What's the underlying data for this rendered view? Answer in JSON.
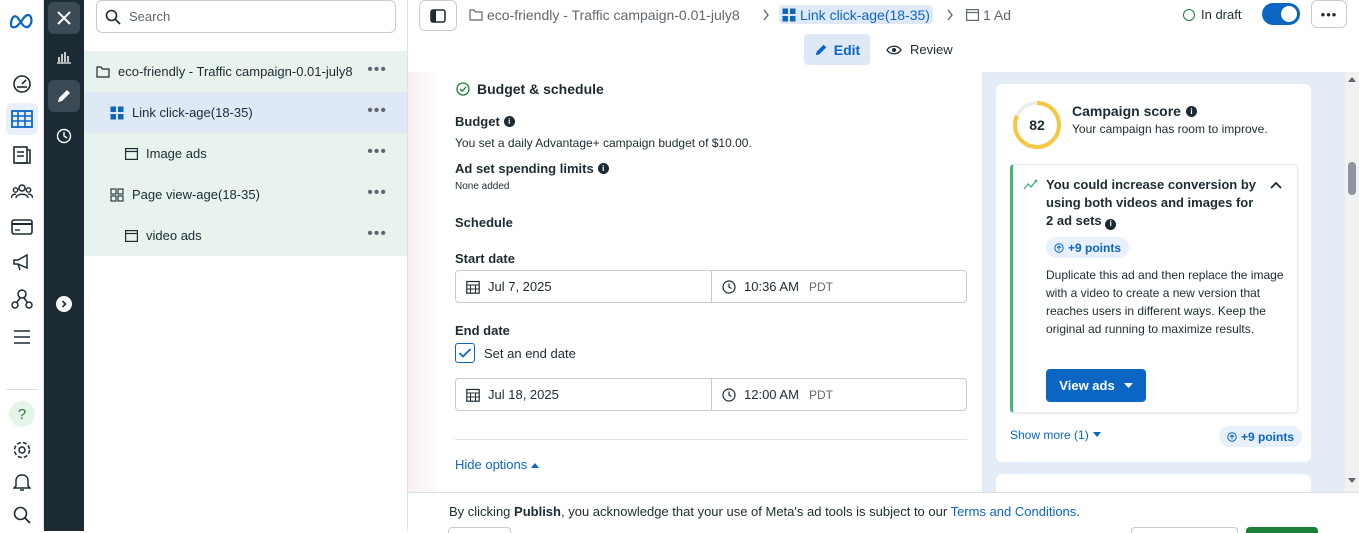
{
  "rail": {
    "items": [
      "meta-logo",
      "dashboard-icon",
      "campaigns-table-icon",
      "catalog-icon",
      "audiences-icon",
      "billing-icon",
      "ads-megaphone-icon",
      "connections-icon",
      "menu-icon",
      "help-icon",
      "settings-icon",
      "notifications-icon",
      "search-icon"
    ]
  },
  "tree": {
    "search_placeholder": "Search",
    "items": [
      {
        "label": "eco-friendly - Traffic campaign-0.01-july8",
        "type": "campaign"
      },
      {
        "label": "Link click-age(18-35)",
        "type": "adset"
      },
      {
        "label": "Image ads",
        "type": "ad"
      },
      {
        "label": "Page view-age(18-35)",
        "type": "adset"
      },
      {
        "label": "video ads",
        "type": "ad"
      }
    ],
    "more_label": "•••"
  },
  "topbar": {
    "breadcrumb": {
      "campaign": "eco-friendly - Traffic campaign-0.01-july8",
      "adset": "Link click-age(18-35)",
      "ad": "1 Ad"
    },
    "status": "In draft",
    "edit_label": "Edit",
    "review_label": "Review",
    "more_label": "•••"
  },
  "budget": {
    "section_title": "Budget & schedule",
    "budget_label": "Budget",
    "budget_text": "You set a daily Advantage+ campaign budget of $10.00.",
    "limits_label": "Ad set spending limits",
    "limits_text": "None added",
    "schedule_label": "Schedule",
    "start_label": "Start date",
    "start_date": "Jul 7, 2025",
    "start_time": "10:36 AM",
    "start_tz": "PDT",
    "end_label": "End date",
    "end_checkbox_label": "Set an end date",
    "end_checked": true,
    "end_date": "Jul 18, 2025",
    "end_time": "12:00 AM",
    "end_tz": "PDT",
    "hide_options": "Hide options"
  },
  "score": {
    "value": "82",
    "title": "Campaign score",
    "subtitle": "Your campaign has room to improve.",
    "reco_title": "You could increase conversion by using both videos and images for 2 ad sets",
    "reco_points": "+9 points",
    "reco_body": "Duplicate this ad and then replace the image with a video to create a new version that reaches users in different ways. Keep the original ad running to maximize results.",
    "view_ads": "View ads",
    "show_more": "Show more (1)",
    "total_points": "+9 points"
  },
  "footer": {
    "prefix": "By clicking ",
    "publish": "Publish",
    "middle": ", you acknowledge that your use of Meta's ad tools is subject to our ",
    "terms": "Terms and Conditions",
    "suffix": "."
  },
  "colors": {
    "accent": "#0a66c2",
    "dark_strip": "#1c2b33",
    "tree_bg": "#e8f3ee",
    "score_ring": "#f5c842",
    "reco_border": "#43b77e"
  }
}
